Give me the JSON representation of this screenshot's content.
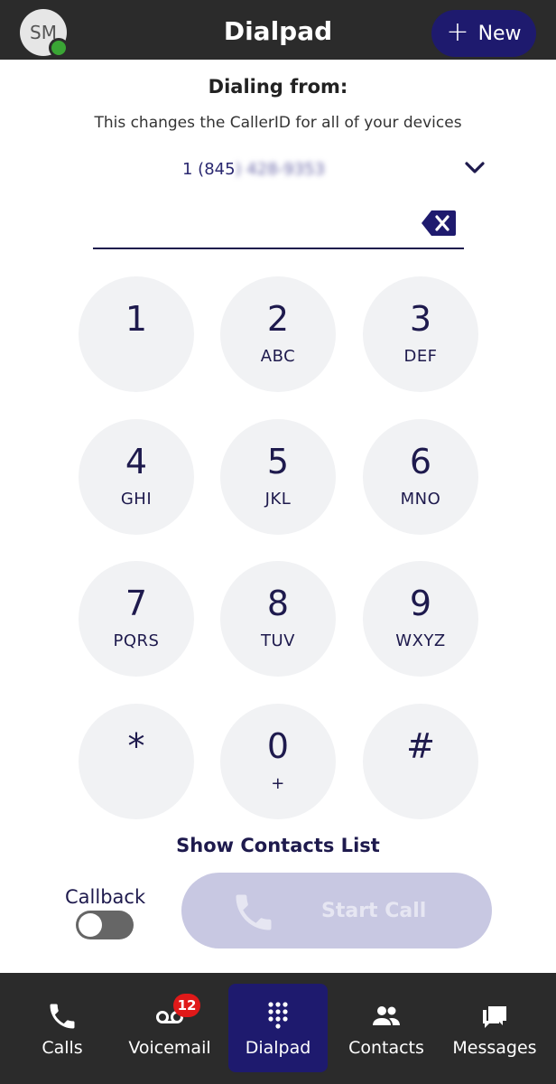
{
  "header": {
    "avatar_initials": "SM",
    "title": "Dialpad",
    "new_button": "New"
  },
  "dialing": {
    "label": "Dialing from:",
    "note": "This changes the CallerID for all of your devices",
    "number_visible": "1 (845",
    "number_blurred": ") 428-9353"
  },
  "input": {
    "value": ""
  },
  "keys": [
    {
      "digit": "1",
      "letters": ""
    },
    {
      "digit": "2",
      "letters": "ABC"
    },
    {
      "digit": "3",
      "letters": "DEF"
    },
    {
      "digit": "4",
      "letters": "GHI"
    },
    {
      "digit": "5",
      "letters": "JKL"
    },
    {
      "digit": "6",
      "letters": "MNO"
    },
    {
      "digit": "7",
      "letters": "PQRS"
    },
    {
      "digit": "8",
      "letters": "TUV"
    },
    {
      "digit": "9",
      "letters": "WXYZ"
    },
    {
      "digit": "*",
      "letters": ""
    },
    {
      "digit": "0",
      "letters": "+"
    },
    {
      "digit": "#",
      "letters": ""
    }
  ],
  "show_contacts": "Show Contacts List",
  "callback": {
    "label": "Callback",
    "enabled": false
  },
  "start_call": "Start Call",
  "nav": {
    "items": [
      {
        "label": "Calls",
        "icon": "phone-icon"
      },
      {
        "label": "Voicemail",
        "icon": "voicemail-icon"
      },
      {
        "label": "Dialpad",
        "icon": "dialpad-icon",
        "active": true
      },
      {
        "label": "Contacts",
        "icon": "contacts-icon"
      },
      {
        "label": "Messages",
        "icon": "messages-icon"
      }
    ],
    "voicemail_badge": "12"
  },
  "colors": {
    "header_bg": "#2b2b2b",
    "accent": "#1e1a6e",
    "key_bg": "#f1f2f4",
    "presence": "#3aa535",
    "badge": "#e01919",
    "start_call_disabled": "#c8c8e2"
  }
}
